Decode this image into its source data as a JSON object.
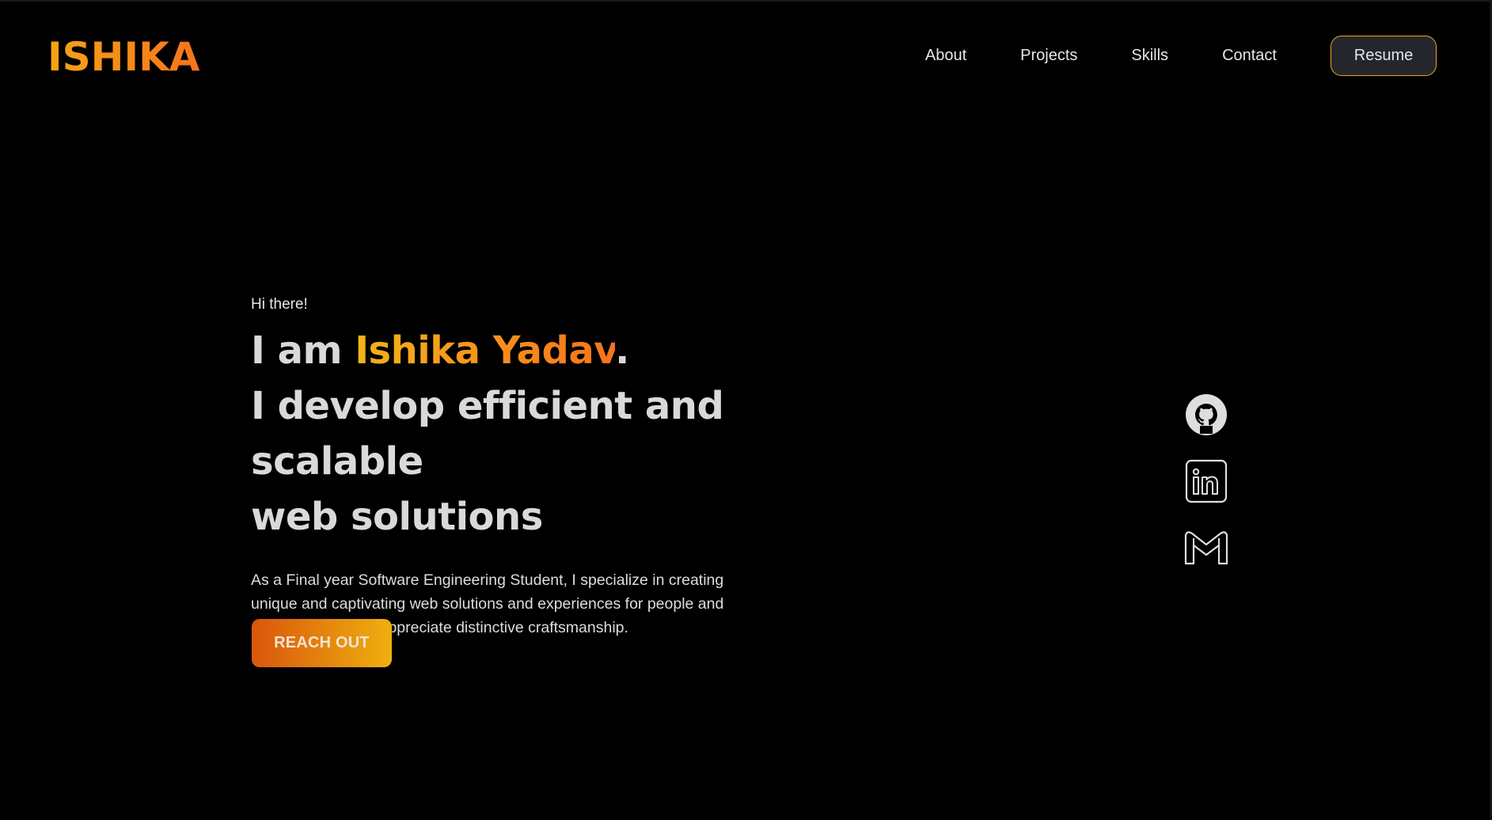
{
  "header": {
    "logo_text": "ISHIKA",
    "nav": [
      {
        "label": "About"
      },
      {
        "label": "Projects"
      },
      {
        "label": "Skills"
      },
      {
        "label": "Contact"
      }
    ],
    "resume_label": "Resume"
  },
  "hero": {
    "greeting": "Hi there!",
    "headline_prefix": "I am ",
    "name": "Ishika Yadav",
    "headline_period": ".",
    "headline_line2": "I develop efficient and scalable",
    "headline_line3": "web solutions",
    "intro": "As a Final year Software Engineering Student, I specialize in creating unique and captivating web solutions and experiences for people and organizations who appreciate distinctive craftsmanship.",
    "cta_label": "REACH OUT"
  },
  "social": [
    {
      "icon": "github-icon"
    },
    {
      "icon": "linkedin-icon"
    },
    {
      "icon": "gmail-icon"
    }
  ],
  "colors": {
    "background": "#000000",
    "accent_start": "#f5b31a",
    "accent_end": "#f5731c",
    "resume_bg": "#23262d",
    "text": "#d9d9d9"
  }
}
